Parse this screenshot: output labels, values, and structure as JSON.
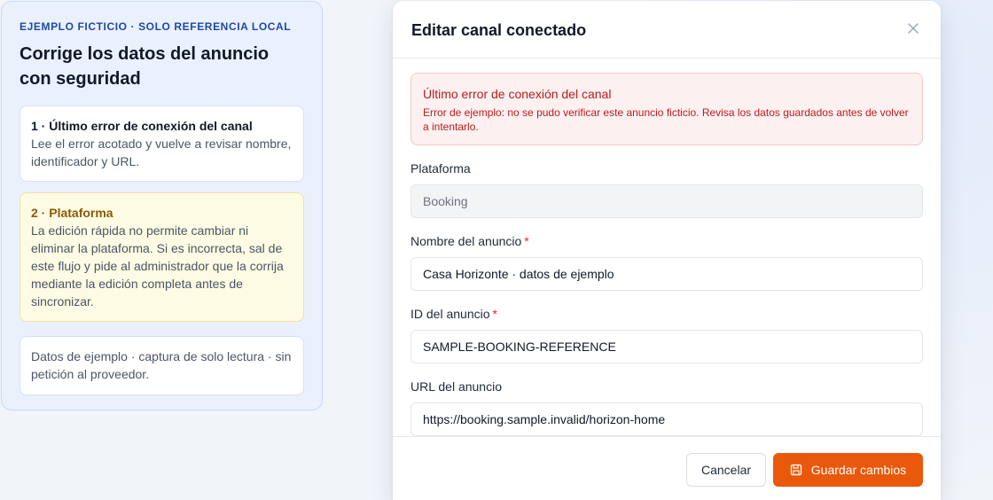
{
  "guide": {
    "kicker": "EJEMPLO FICTICIO · SOLO REFERENCIA LOCAL",
    "title": "Corrige los datos del anuncio con seguridad",
    "steps": [
      {
        "title": "1 · Último error de conexión del canal",
        "body": "Lee el error acotado y vuelve a revisar nombre, identificador y URL."
      },
      {
        "title": "2 · Plataforma",
        "body": "La edición rápida no permite cambiar ni eliminar la plataforma. Si es incorrecta, sal de este flujo y pide al administrador que la corrija mediante la edición completa antes de sincronizar."
      }
    ],
    "note": "Datos de ejemplo · captura de solo lectura · sin petición al proveedor."
  },
  "modal": {
    "title": "Editar canal conectado",
    "close_icon": "close-icon",
    "alert": {
      "title": "Último error de conexión del canal",
      "body": "Error de ejemplo: no se pudo verificar este anuncio ficticio. Revisa los datos guardados antes de volver a intentarlo."
    },
    "fields": {
      "platform": {
        "label": "Plataforma",
        "value": "Booking",
        "disabled": true
      },
      "name": {
        "label": "Nombre del anuncio",
        "required_mark": "*",
        "value": "Casa Horizonte · datos de ejemplo"
      },
      "listing_id": {
        "label": "ID del anuncio",
        "required_mark": "*",
        "value": "SAMPLE-BOOKING-REFERENCE"
      },
      "url": {
        "label": "URL del anuncio",
        "value": "https://booking.sample.invalid/horizon-home"
      }
    },
    "footer": {
      "cancel_label": "Cancelar",
      "save_label": "Guardar cambios",
      "save_icon": "save-icon"
    }
  },
  "colors": {
    "accent": "#ea580c",
    "error": "#b91c1c",
    "guide_bg": "#eaf1fd",
    "warning_bg": "#fefbe4"
  }
}
